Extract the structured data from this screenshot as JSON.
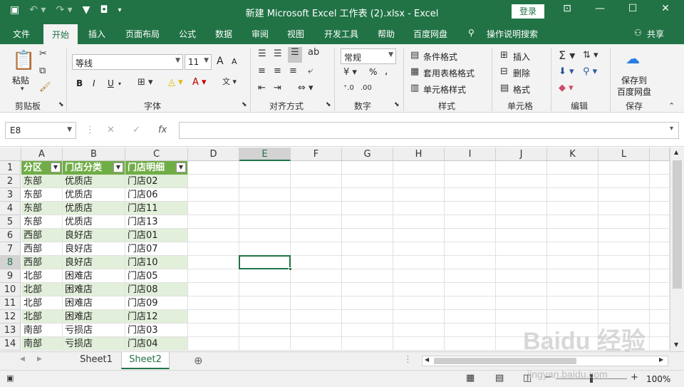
{
  "titlebar": {
    "title": "新建 Microsoft Excel 工作表 (2).xlsx  -  Excel",
    "login_label": "登录"
  },
  "tabs": [
    "文件",
    "开始",
    "插入",
    "页面布局",
    "公式",
    "数据",
    "审阅",
    "视图",
    "开发工具",
    "帮助",
    "百度网盘",
    "操作说明搜索",
    "共享"
  ],
  "ribbon": {
    "clipboard": {
      "paste": "粘贴",
      "label": "剪贴板"
    },
    "font": {
      "name": "等线",
      "size": "11",
      "bold": "B",
      "italic": "I",
      "underline": "U",
      "grow": "A",
      "shrink": "A",
      "label": "字体"
    },
    "alignment": {
      "label": "对齐方式"
    },
    "number": {
      "format": "常规",
      "percent": "%",
      "comma": ",",
      "label": "数字"
    },
    "styles": {
      "conditional": "条件格式",
      "table": "套用表格格式",
      "cell": "单元格样式",
      "label": "样式"
    },
    "cells": {
      "insert": "插入",
      "delete": "删除",
      "format": "格式",
      "label": "单元格"
    },
    "editing": {
      "label": "编辑"
    },
    "save": {
      "label1": "保存到",
      "label2": "百度网盘",
      "label": "保存"
    }
  },
  "formula_bar": {
    "name_box": "E8",
    "formula": "",
    "fx": "fx"
  },
  "columns": [
    "A",
    "B",
    "C",
    "D",
    "E",
    "F",
    "G",
    "H",
    "I",
    "J",
    "K",
    "L"
  ],
  "rows": [
    "1",
    "2",
    "3",
    "4",
    "5",
    "6",
    "7",
    "8",
    "9",
    "10",
    "11",
    "12",
    "13",
    "14"
  ],
  "table": {
    "headers": [
      "分区",
      "门店分类",
      "门店明细"
    ],
    "rows": [
      [
        "东部",
        "优质店",
        "门店02"
      ],
      [
        "东部",
        "优质店",
        "门店06"
      ],
      [
        "东部",
        "优质店",
        "门店11"
      ],
      [
        "东部",
        "优质店",
        "门店13"
      ],
      [
        "西部",
        "良好店",
        "门店01"
      ],
      [
        "西部",
        "良好店",
        "门店07"
      ],
      [
        "西部",
        "良好店",
        "门店10"
      ],
      [
        "北部",
        "困难店",
        "门店05"
      ],
      [
        "北部",
        "困难店",
        "门店08"
      ],
      [
        "北部",
        "困难店",
        "门店09"
      ],
      [
        "北部",
        "困难店",
        "门店12"
      ],
      [
        "南部",
        "亏损店",
        "门店03"
      ],
      [
        "南部",
        "亏损店",
        "门店04"
      ]
    ]
  },
  "sheets": [
    "Sheet1",
    "Sheet2"
  ],
  "active_sheet": "Sheet2",
  "status": {
    "zoom": "100%"
  },
  "watermark": {
    "line1": "Baidu 经验",
    "line2": "jingyan.baidu.com"
  },
  "colors": {
    "accent": "#217346",
    "table_header": "#70ad47",
    "table_band": "#e2efda"
  }
}
